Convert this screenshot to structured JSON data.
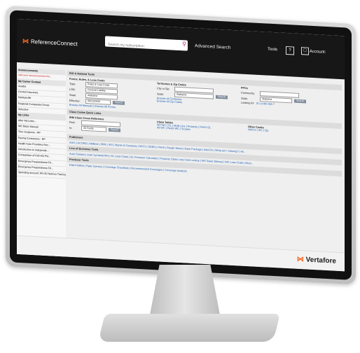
{
  "brand": {
    "name": "ReferenceConnect",
    "footer": "Vertafore"
  },
  "header": {
    "search_placeholder": "Search my subscription",
    "advanced": "Advanced Search",
    "tools": "Tools",
    "help": "?",
    "account": "Account:"
  },
  "sidebar": [
    {
      "type": "h",
      "t": "Announcements"
    },
    {
      "type": "red",
      "t": "Add your announcement her..."
    },
    {
      "type": "h",
      "t": "My Carrier Content"
    },
    {
      "type": "i",
      "t": "Acadia"
    },
    {
      "type": "i",
      "t": "Central Insurance"
    },
    {
      "type": "i",
      "t": "Harleysville"
    },
    {
      "type": "i",
      "t": "Regional Companies Group"
    },
    {
      "type": "i",
      "t": "Selective"
    },
    {
      "type": "h",
      "t": "My Links"
    },
    {
      "type": "i",
      "t": "After My Links..."
    },
    {
      "type": "i",
      "t": "WC Basic Manual"
    },
    {
      "type": "i",
      "t": "Tree Surgeons - RP"
    },
    {
      "type": "i",
      "t": "Paving Contractors - RP"
    },
    {
      "type": "i",
      "t": "Health Care Providers Rec..."
    },
    {
      "type": "i",
      "t": "Introduction to Independe..."
    },
    {
      "type": "i",
      "t": "Comparison of ISO HO Pol..."
    },
    {
      "type": "i",
      "t": "Emergency Preparedness Ch..."
    },
    {
      "type": "i",
      "t": "Emergency Preparedness Ch..."
    },
    {
      "type": "i",
      "t": "Spending account: WV BJ NetCon Training"
    }
  ],
  "iso": {
    "title": "ISO & Related Tools",
    "forms": {
      "title": "Forms, Rules, & Loss Costs",
      "type_label": "Type:",
      "type_value": "Rules & Loss Costs",
      "lob_label": "LOB:",
      "lob_value": "General Liability",
      "state_label": "State:",
      "state_value": "Alabama",
      "eff_label": "Effective:",
      "eff_value": "06/12/2020",
      "search": "Search",
      "links": "Browse All Manuals | Browse All Forms"
    },
    "terr": {
      "title": "Territories & Zip Codes",
      "city_label": "City or Zip:",
      "state_label": "State:",
      "state_value": "Alabama",
      "search": "Search",
      "link1": "Browse All Territories",
      "link2": "Browse All Zip Codes"
    },
    "ppc": {
      "title": "PPCs",
      "community_label": "Community:",
      "state_label": "State:",
      "state_value": "Alabama",
      "search": "Search",
      "looking": "Looking for",
      "looking_links": "ID  LA  MS  WA ?"
    }
  },
  "class": {
    "title": "Class Codes Quick Links",
    "irm": {
      "title": "IRM Class Cross Reference",
      "find_label": "Find:",
      "in_label": "In:",
      "in_value": "All Fields",
      "search": "Search"
    },
    "tables": {
      "title": "Class Tables",
      "row1": "All P&C | GL | Multi-Line | Property | PAAS GL",
      "row2": "All WC | PAAS WC | Scopes"
    },
    "other": {
      "title": "Other Codes",
      "row": "NAICS | SIC | Zip"
    }
  },
  "publishers": {
    "title": "Publishers",
    "row": "AAIS | ACORD | AMBest | IRMI | ISO | Martin & Company | NCCI | ODEN | PAAS | Rough Notes | Base Package | Add-On | What am I missing? | All..."
  },
  "lob": {
    "title": "Line of Business Tools",
    "row": "Auto Classes | Auto Symbols/VIN | GL Loss Costs | GL Premium Calculator | Property Class Loss Cost Lookup | WC Basic Manual | WC Loss Costs | More..."
  },
  "producer": {
    "title": "Producer Tools",
    "row": "Risk Profiles | Rate Surveys | Coverage Checklists | Recommended Coverages | Coverage Analysis"
  }
}
